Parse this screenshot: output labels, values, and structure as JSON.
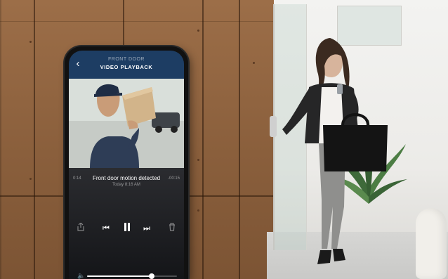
{
  "app": {
    "camera_name": "FRONT DOOR",
    "header_title": "VIDEO PLAYBACK"
  },
  "event": {
    "title": "Front door motion detected",
    "time": "Today 8:16 AM",
    "elapsed": "0:14",
    "remaining": "-00:15"
  },
  "controls": {
    "share_icon": "share-icon",
    "rewind_icon": "rewind-icon",
    "pause_icon": "pause-icon",
    "forward_icon": "fast-forward-icon",
    "delete_icon": "trash-icon"
  },
  "volume": {
    "level": 0.72
  },
  "colors": {
    "header": "#1d3d63",
    "panel": "#1a1b1f"
  }
}
